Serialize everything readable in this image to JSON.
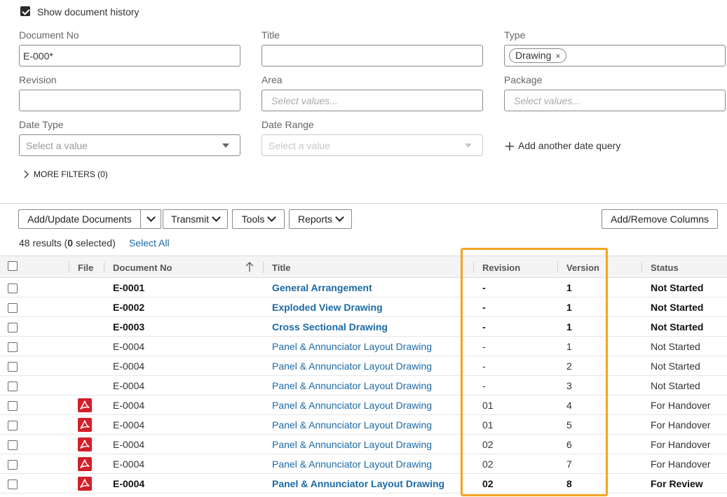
{
  "filters": {
    "show_history_label": "Show document history",
    "show_history_checked": true,
    "document_no": {
      "label": "Document No",
      "value": "E-000*"
    },
    "title": {
      "label": "Title",
      "value": ""
    },
    "type": {
      "label": "Type",
      "chip": "Drawing",
      "chip_remove": "×"
    },
    "revision": {
      "label": "Revision",
      "value": ""
    },
    "area": {
      "label": "Area",
      "placeholder": "Select values..."
    },
    "package": {
      "label": "Package",
      "placeholder": "Select values..."
    },
    "date_type": {
      "label": "Date Type",
      "placeholder": "Select a value"
    },
    "date_range": {
      "label": "Date Range",
      "placeholder": "Select a value"
    },
    "add_date_query": "Add another date query",
    "more_filters": "MORE FILTERS (0)"
  },
  "toolbar": {
    "add_update": "Add/Update Documents",
    "transmit": "Transmit",
    "tools": "Tools",
    "reports": "Reports",
    "add_remove_columns": "Add/Remove Columns"
  },
  "results": {
    "count": "48",
    "prefix_results": " results (",
    "selected": "0",
    "suffix_selected": " selected)",
    "select_all": "Select All"
  },
  "table": {
    "columns": [
      "File",
      "Document No",
      "Title",
      "Revision",
      "Version",
      "Status"
    ],
    "rows": [
      {
        "doc": "E-0001",
        "title": "General Arrangement",
        "revision": "-",
        "version": "1",
        "status": "Not Started",
        "pdf": false,
        "bold": true
      },
      {
        "doc": "E-0002",
        "title": "Exploded View Drawing",
        "revision": "-",
        "version": "1",
        "status": "Not Started",
        "pdf": false,
        "bold": true
      },
      {
        "doc": "E-0003",
        "title": "Cross Sectional Drawing",
        "revision": "-",
        "version": "1",
        "status": "Not Started",
        "pdf": false,
        "bold": true
      },
      {
        "doc": "E-0004",
        "title": "Panel & Annunciator Layout Drawing",
        "revision": "-",
        "version": "1",
        "status": "Not Started",
        "pdf": false,
        "bold": false
      },
      {
        "doc": "E-0004",
        "title": "Panel & Annunciator Layout Drawing",
        "revision": "-",
        "version": "2",
        "status": "Not Started",
        "pdf": false,
        "bold": false
      },
      {
        "doc": "E-0004",
        "title": "Panel & Annunciator Layout Drawing",
        "revision": "-",
        "version": "3",
        "status": "Not Started",
        "pdf": false,
        "bold": false
      },
      {
        "doc": "E-0004",
        "title": "Panel & Annunciator Layout Drawing",
        "revision": "01",
        "version": "4",
        "status": "For Handover",
        "pdf": true,
        "bold": false
      },
      {
        "doc": "E-0004",
        "title": "Panel & Annunciator Layout Drawing",
        "revision": "01",
        "version": "5",
        "status": "For Handover",
        "pdf": true,
        "bold": false
      },
      {
        "doc": "E-0004",
        "title": "Panel & Annunciator Layout Drawing",
        "revision": "02",
        "version": "6",
        "status": "For Handover",
        "pdf": true,
        "bold": false
      },
      {
        "doc": "E-0004",
        "title": "Panel & Annunciator Layout Drawing",
        "revision": "02",
        "version": "7",
        "status": "For Handover",
        "pdf": true,
        "bold": false
      },
      {
        "doc": "E-0004",
        "title": "Panel & Annunciator Layout Drawing",
        "revision": "02",
        "version": "8",
        "status": "For Review",
        "pdf": true,
        "bold": true
      }
    ]
  },
  "colors": {
    "link": "#1b6aa5",
    "highlight": "#f2a51f",
    "pdf": "#d21f2a"
  },
  "icons": [
    "checkbox-icon",
    "chevron-down-icon",
    "plus-icon",
    "chevron-right-icon",
    "sort-ascending-icon",
    "pdf-icon"
  ]
}
